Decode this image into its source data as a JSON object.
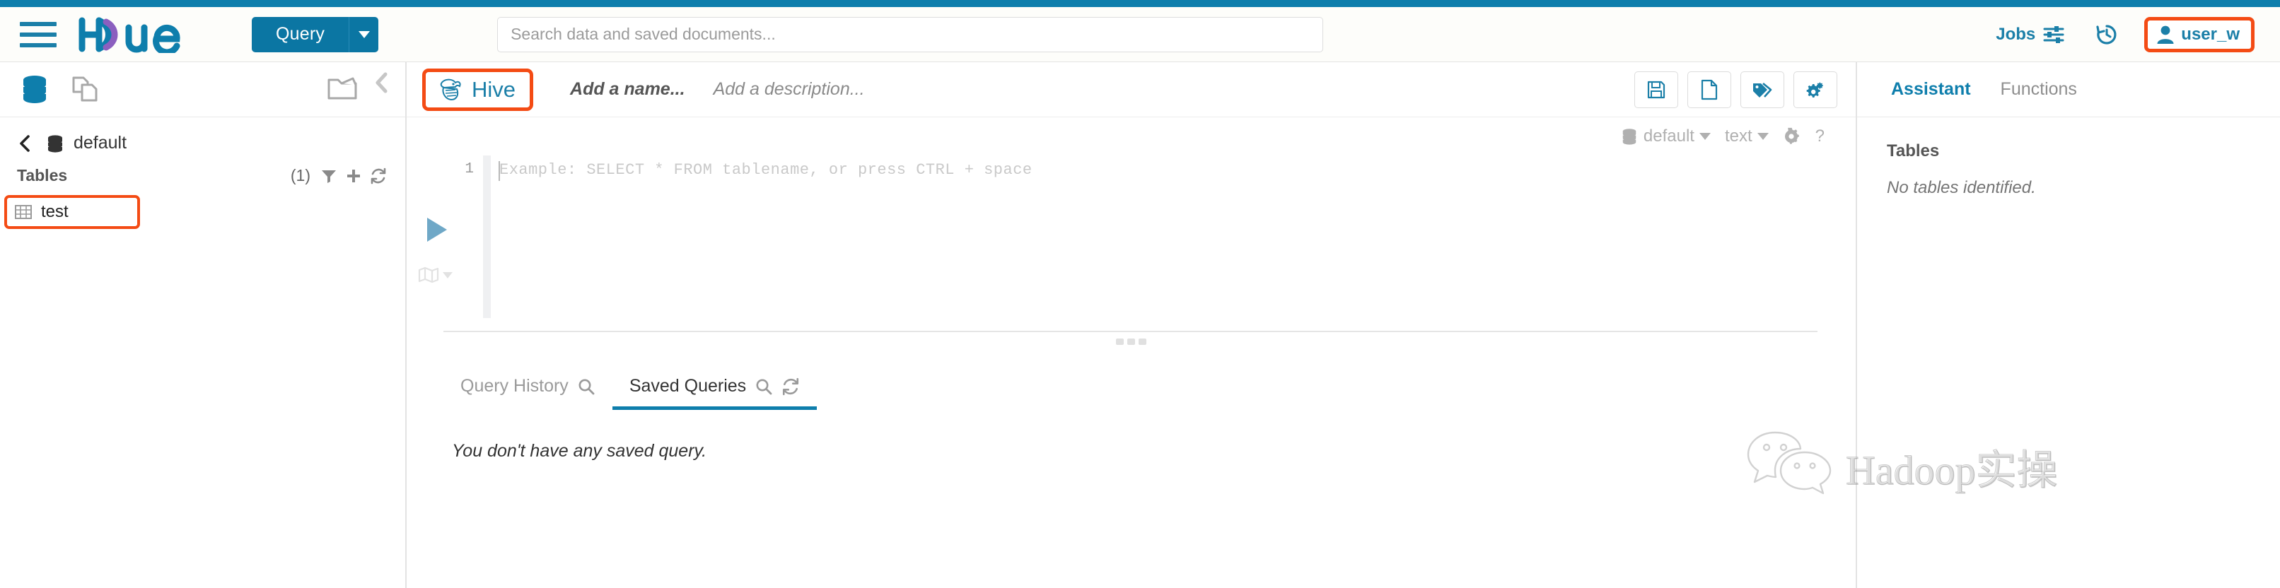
{
  "app": {
    "name": "Hue",
    "accent_color": "#0E7EAC",
    "highlight_color": "#F44B14"
  },
  "navbar": {
    "hamburger_icon": "hamburger-menu-icon",
    "logo_text": "hue",
    "query_button": "Query",
    "query_caret_icon": "chevron-down-icon",
    "search": {
      "placeholder": "Search data and saved documents...",
      "value": "",
      "icon": "search-icon"
    },
    "jobs": {
      "label": "Jobs",
      "icon": "sliders-icon"
    },
    "history_icon": "history-clock-icon",
    "user": {
      "label": "user_w",
      "icon": "user-icon",
      "highlighted": true
    }
  },
  "left_panel": {
    "tabs": [
      {
        "name": "database-icon",
        "label": "Databases",
        "active": true
      },
      {
        "name": "documents-icon",
        "label": "Documents",
        "active": false
      }
    ],
    "right_icons": [
      {
        "name": "open-folder-icon",
        "label": "Browse"
      },
      {
        "name": "collapse-left-icon",
        "label": "Collapse"
      }
    ],
    "breadcrumb": {
      "back_icon": "chevron-left-icon",
      "db_icon": "database-icon",
      "database": "default"
    },
    "tables_header": {
      "title": "Tables",
      "count": "(1)",
      "actions": [
        {
          "name": "filter-icon",
          "label": "Filter"
        },
        {
          "name": "plus-icon",
          "label": "Add"
        },
        {
          "name": "refresh-icon",
          "label": "Refresh"
        }
      ]
    },
    "tables": [
      {
        "name": "test",
        "icon": "table-icon",
        "highlighted": true
      }
    ]
  },
  "editor": {
    "engine_tab": {
      "label": "Hive",
      "icon": "hive-logo-icon",
      "highlighted": true
    },
    "name_placeholder": "Add a name...",
    "description_placeholder": "Add a description...",
    "toolbar": [
      {
        "name": "save-icon",
        "label": "Save"
      },
      {
        "name": "new-document-icon",
        "label": "New query"
      },
      {
        "name": "tags-icon",
        "label": "Tags"
      },
      {
        "name": "settings-gears-icon",
        "label": "Settings"
      }
    ],
    "subbar": {
      "database": "default",
      "database_icon": "database-icon",
      "format": "text",
      "gear_icon": "gear-icon",
      "help_icon": "question-mark-icon"
    },
    "gutter": {
      "run_icon": "play-triangle-icon",
      "map_icon": "map-icon",
      "map_caret_icon": "chevron-down-icon"
    },
    "code": {
      "line_number": "1",
      "placeholder": "Example: SELECT * FROM tablename, or press CTRL + space",
      "value": ""
    }
  },
  "results": {
    "tabs": [
      {
        "label": "Query History",
        "icon": "search-icon",
        "active": false
      },
      {
        "label": "Saved Queries",
        "icon": "search-icon",
        "icon2": "refresh-icon",
        "active": true
      }
    ],
    "empty_message": "You don't have any saved query."
  },
  "right_panel": {
    "tabs": [
      {
        "label": "Assistant",
        "active": true
      },
      {
        "label": "Functions",
        "active": false
      }
    ],
    "section_title": "Tables",
    "empty_message": "No tables identified."
  },
  "watermark": {
    "text": "Hadoop实操",
    "icon": "wechat-logo-icon"
  }
}
